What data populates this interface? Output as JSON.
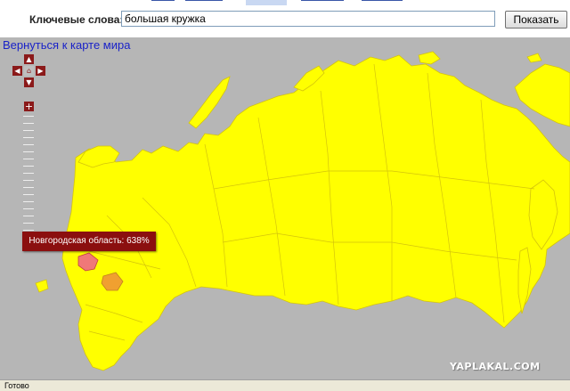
{
  "search": {
    "label": "Ключевые слова:",
    "value": "большая кружка",
    "button_label": "Показать"
  },
  "map": {
    "back_link": "Вернуться к карте мира",
    "tooltip": "Новгородская область: 638%",
    "watermark": "YAPLAKAL.COM",
    "colors": {
      "background": "#b6b6b6",
      "region_fill": "#ffff00",
      "border": "#d4c40c",
      "highlight": "#f07878",
      "secondary": "#f0a030",
      "tooltip_bg": "#8b0f0f",
      "control": "#8b1a1a"
    },
    "controls": {
      "up_icon": "▲",
      "down_icon": "▼",
      "left_icon": "◀",
      "right_icon": "▶",
      "home_icon": "⌂",
      "zoom_in": "+"
    }
  },
  "status": {
    "text": "Готово"
  }
}
